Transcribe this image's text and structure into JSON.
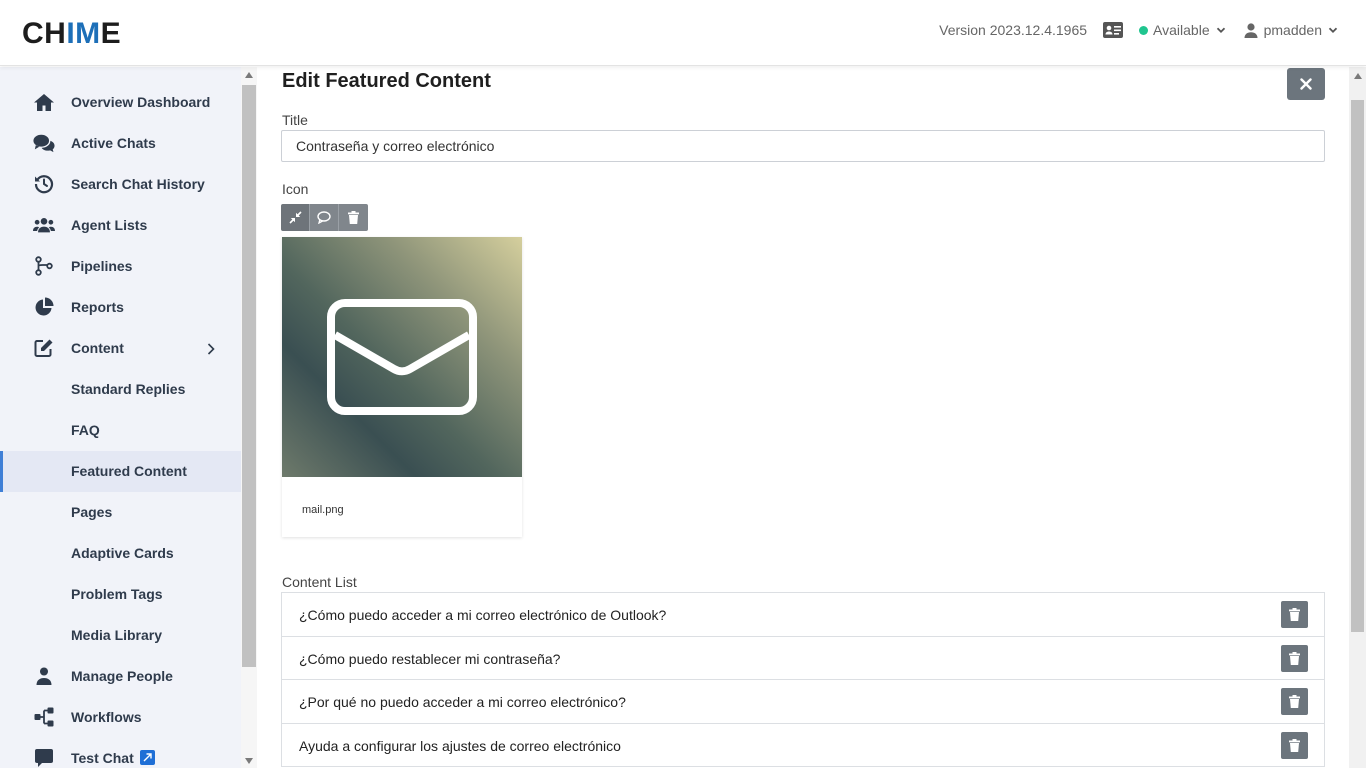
{
  "header": {
    "logo_prefix": "CH",
    "logo_accent": "IM",
    "logo_suffix": "E",
    "version": "Version 2023.12.4.1965",
    "status": "Available",
    "status_color": "#20c58f",
    "username": "pmadden"
  },
  "sidebar": {
    "items": [
      {
        "label": "Overview Dashboard",
        "icon": "home-icon"
      },
      {
        "label": "Active Chats",
        "icon": "chat-bubbles-icon"
      },
      {
        "label": "Search Chat History",
        "icon": "history-icon"
      },
      {
        "label": "Agent Lists",
        "icon": "users-icon"
      },
      {
        "label": "Pipelines",
        "icon": "branch-icon"
      },
      {
        "label": "Reports",
        "icon": "pie-chart-icon"
      },
      {
        "label": "Content",
        "icon": "edit-icon"
      },
      {
        "label": "Standard Replies"
      },
      {
        "label": "FAQ"
      },
      {
        "label": "Featured Content"
      },
      {
        "label": "Pages"
      },
      {
        "label": "Adaptive Cards"
      },
      {
        "label": "Problem Tags"
      },
      {
        "label": "Media Library"
      },
      {
        "label": "Manage People",
        "icon": "user-icon"
      },
      {
        "label": "Workflows",
        "icon": "workflow-icon"
      },
      {
        "label": "Test Chat",
        "icon": "chat-icon"
      }
    ],
    "active": "Featured Content"
  },
  "main": {
    "page_title": "Edit Featured Content",
    "title_label": "Title",
    "title_value": "Contraseña y correo electrónico",
    "icon_label": "Icon",
    "icon_file_name": "mail.png",
    "content_list_label": "Content List",
    "content_list": [
      "¿Cómo puedo acceder a mi correo electrónico de Outlook?",
      "¿Cómo puedo restablecer mi contraseña?",
      "¿Por qué no puedo acceder a mi correo electrónico?",
      "Ayuda a configurar los ajustes de correo electrónico"
    ]
  },
  "colors": {
    "accent": "#3f7fd6",
    "button_gray": "#6c757d",
    "sidebar_bg": "#f1f3f9"
  }
}
